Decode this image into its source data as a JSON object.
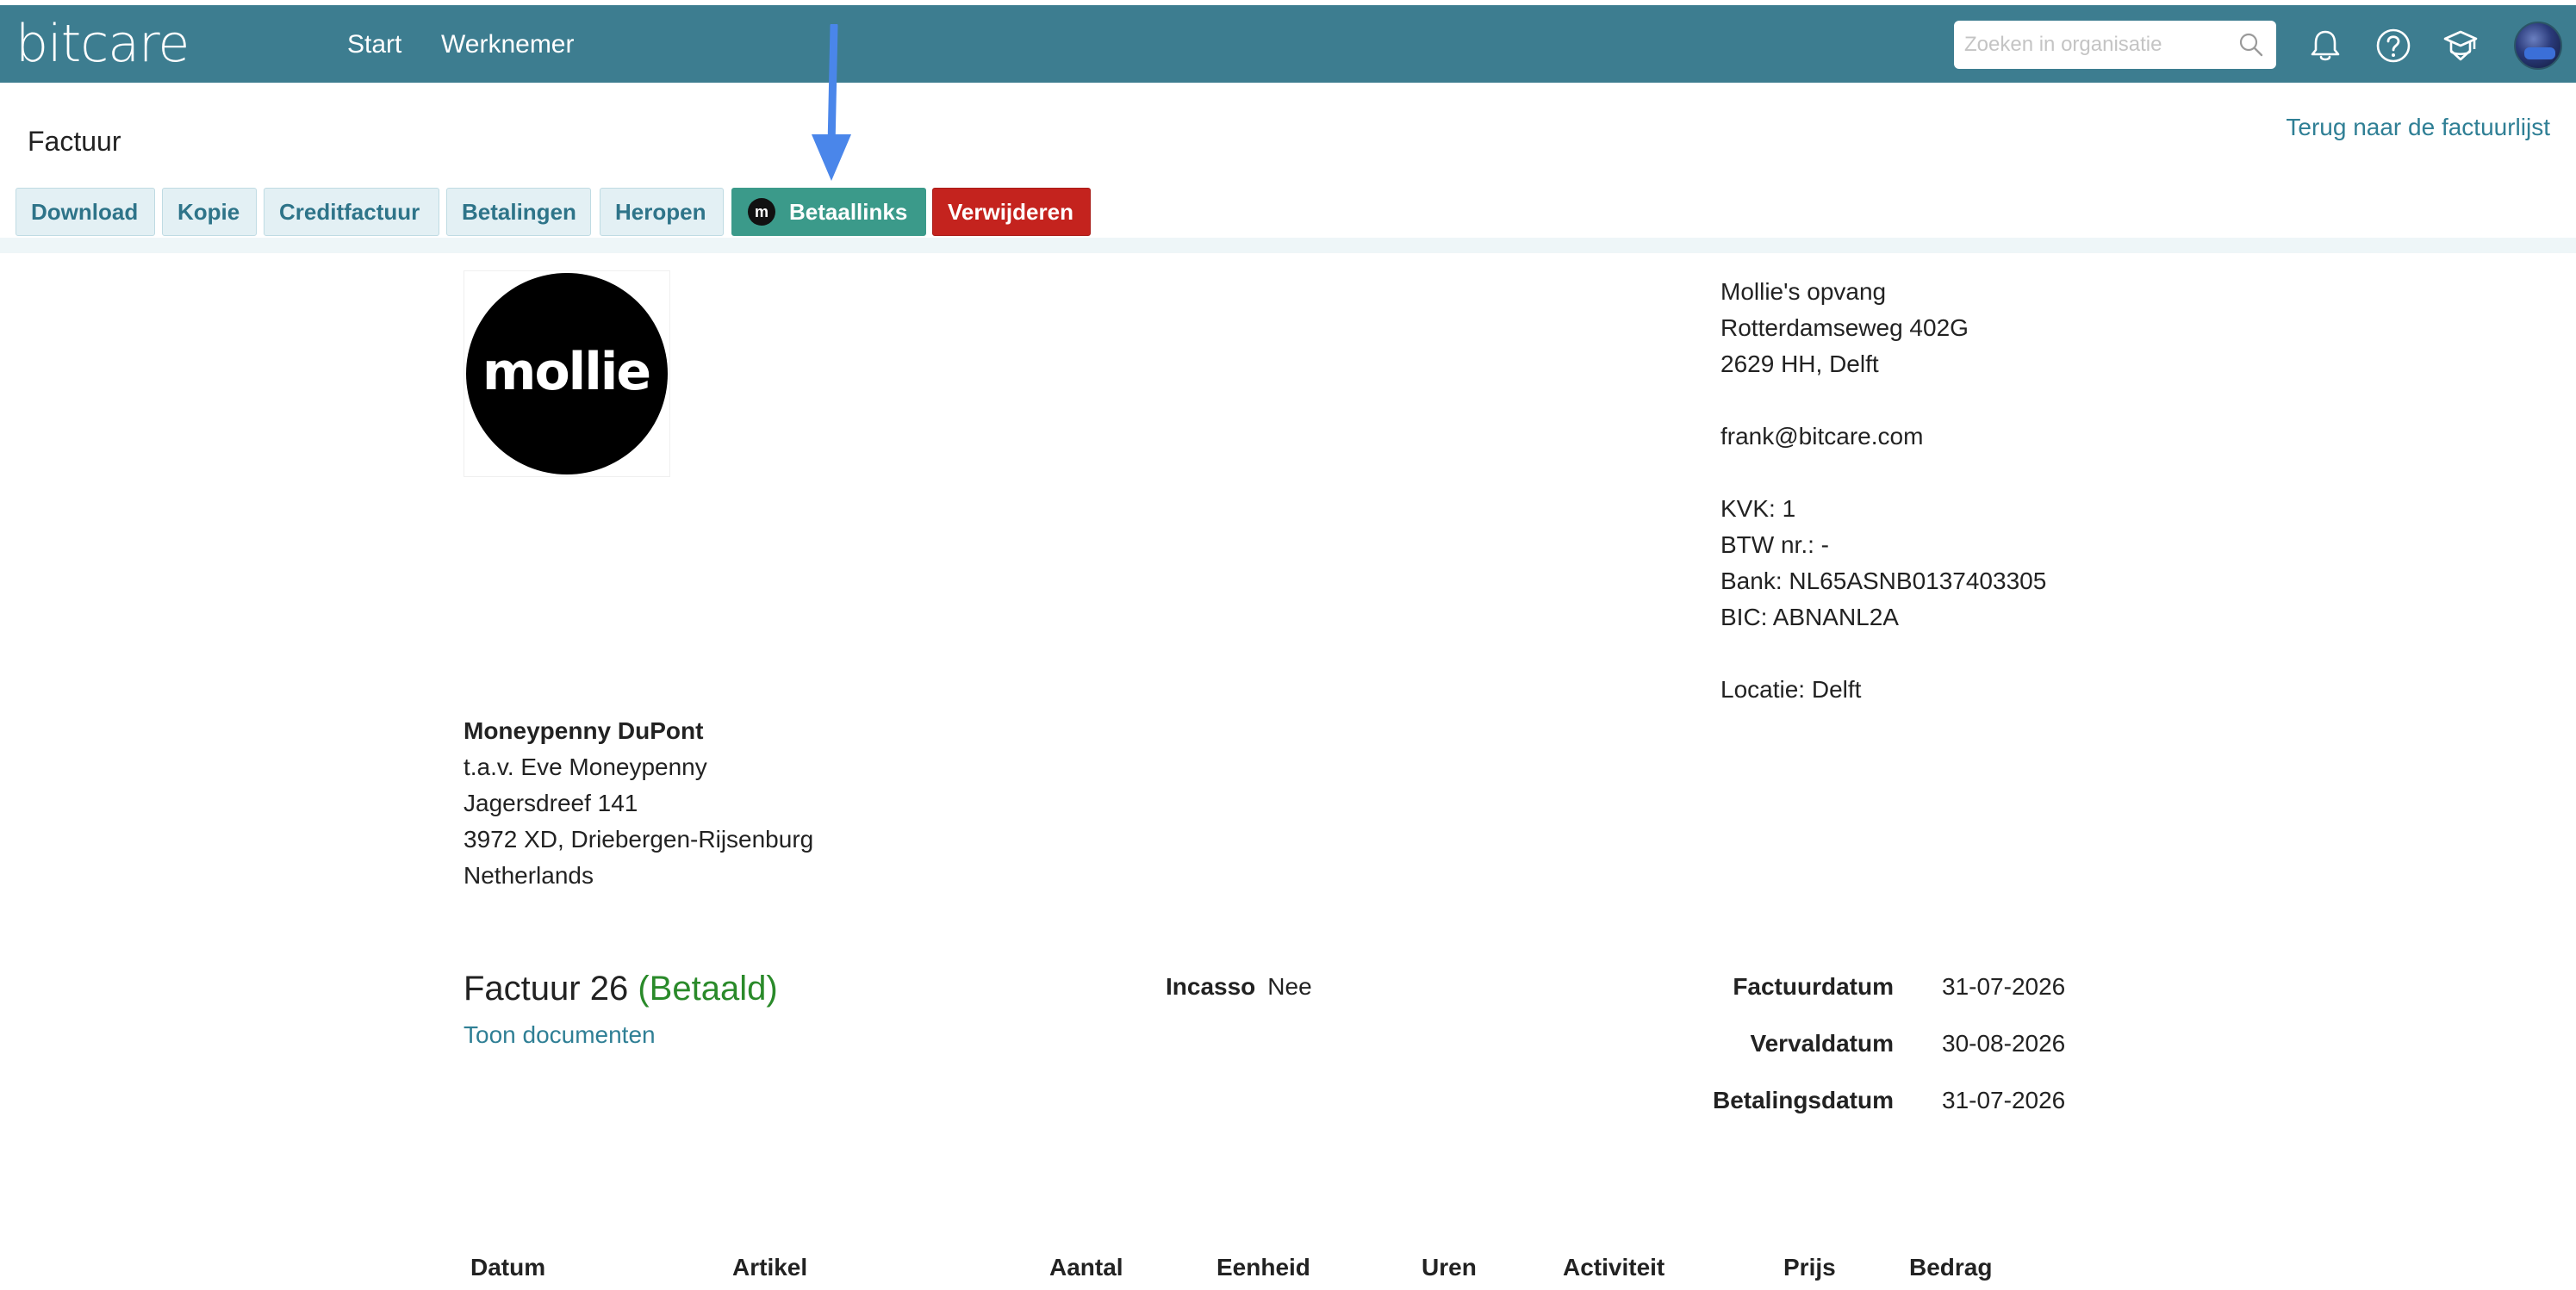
{
  "app": {
    "logo": "bitcare",
    "nav": [
      {
        "label": "Start"
      },
      {
        "label": "Werknemer"
      }
    ],
    "search": {
      "placeholder": "Zoeken in organisatie",
      "value": ""
    },
    "icons": [
      "search-icon",
      "bell-icon",
      "help-icon",
      "graduation-cap-icon",
      "avatar"
    ],
    "colors": {
      "topbar": "#3d7d90",
      "primary_link": "#2f7f95",
      "betaallinks": "#3b9a8a",
      "danger": "#c4231e",
      "paid_status": "#2a8a2a",
      "annotation_arrow": "#4a86ea"
    }
  },
  "header": {
    "title": "Factuur",
    "back_link": "Terug naar de factuurlijst"
  },
  "toolbar": {
    "download": "Download",
    "kopie": "Kopie",
    "creditfactuur": "Creditfactuur",
    "betalingen": "Betalingen",
    "heropen": "Heropen",
    "betaallinks": "Betaallinks",
    "betaallinks_badge": "m",
    "verwijderen": "Verwijderen"
  },
  "invoice": {
    "logo_text": "mollie",
    "company": {
      "name": "Mollie's opvang",
      "street": "Rotterdamseweg 402G",
      "city": "2629 HH, Delft",
      "email": "frank@bitcare.com",
      "kvk": "KVK: 1",
      "btw": "BTW nr.: -",
      "bank": "Bank: NL65ASNB0137403305",
      "bic": "BIC: ABNANL2A",
      "location": "Locatie: Delft"
    },
    "recipient": {
      "name": "Moneypenny DuPont",
      "attention": "t.a.v. Eve Moneypenny",
      "street": "Jagersdreef 141",
      "city": "3972 XD, Driebergen-Rijsenburg",
      "country": "Netherlands"
    },
    "title": "Factuur 26",
    "status": "(Betaald)",
    "documents_link": "Toon documenten",
    "incasso_label": "Incasso",
    "incasso_value": "Nee",
    "dates": [
      {
        "label": "Factuurdatum",
        "value": "31-07-2026"
      },
      {
        "label": "Vervaldatum",
        "value": "30-08-2026"
      },
      {
        "label": "Betalingsdatum",
        "value": "31-07-2026"
      }
    ],
    "table_headers": [
      "Datum",
      "Artikel",
      "Aantal",
      "Eenheid",
      "Uren",
      "Activiteit",
      "Prijs",
      "Bedrag"
    ]
  }
}
